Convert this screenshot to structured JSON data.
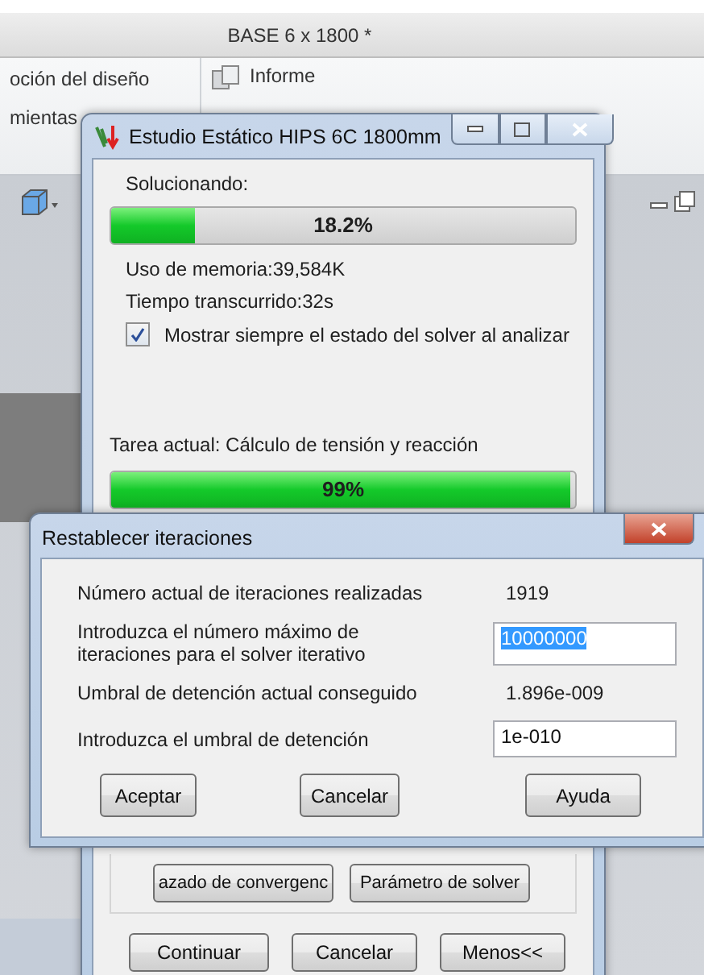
{
  "app": {
    "title": "BASE 6 x 1800 *",
    "ribbon": [
      {
        "label": "oción del diseño"
      },
      {
        "label": "mientas"
      },
      {
        "label": "Informe"
      }
    ]
  },
  "solver_window": {
    "title": "Estudio Estático HIPS 6C 1800mm",
    "status_label": "Solucionando:",
    "progress": {
      "level": 0.182,
      "reading": "18.2%"
    },
    "memory": "Uso de memoria:39,584K",
    "elapsed": "Tiempo transcurrido:32s",
    "show_status": {
      "label": "Mostrar siempre el estado del solver al analizar",
      "checked": true
    },
    "task": "Tarea actual: Cálculo de tensión y reacción",
    "task_progress": {
      "level": 0.99,
      "reading": "99%"
    },
    "tool_buttons": [
      "azado de convergenc",
      "Parámetro de solver"
    ],
    "buttons": [
      "Continuar",
      "Cancelar",
      "Menos<<"
    ]
  },
  "dialog": {
    "title": "Restablecer iteraciones",
    "rows": [
      {
        "kind": "value",
        "label": "Número actual de iteraciones realizadas",
        "value": "1919"
      },
      {
        "kind": "input",
        "label": "Introduzca el número máximo de iteraciones para el solver iterativo",
        "value": "10000000",
        "selected": true
      },
      {
        "kind": "value",
        "label": "Umbral de detención actual conseguido",
        "value": "1.896e-009"
      },
      {
        "kind": "input",
        "label": "Introduzca el umbral de detención",
        "value": "1e-010",
        "selected": false
      }
    ],
    "buttons": [
      "Aceptar",
      "Cancelar",
      "Ayuda"
    ]
  }
}
